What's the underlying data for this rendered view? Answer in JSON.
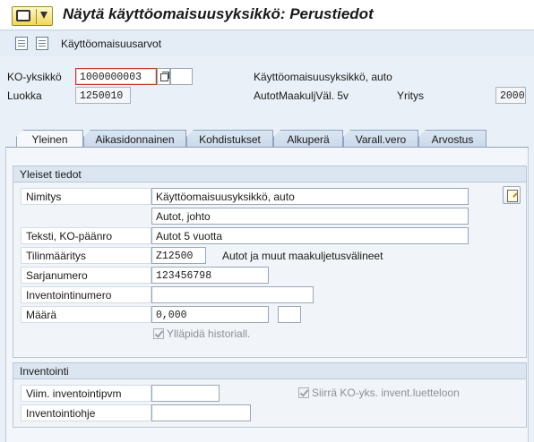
{
  "window": {
    "title": "Näytä käyttöomaisuusyksikkö:  Perustiedot"
  },
  "toolbar": {
    "asset_values_label": "Käyttöomaisuusarvot"
  },
  "header": {
    "asset_label": "KO-yksikkö",
    "asset_value": "1000000003",
    "subnumber_value": "",
    "asset_description": "Käyttöomaisuusyksikkö, auto",
    "class_label": "Luokka",
    "class_value": "1250010",
    "class_description": "AutotMaakuljVäl. 5v",
    "company_label": "Yritys",
    "company_value": "2000"
  },
  "tabs": [
    {
      "label": "Yleinen",
      "active": true
    },
    {
      "label": "Aikasidonnainen",
      "active": false
    },
    {
      "label": "Kohdistukset",
      "active": false
    },
    {
      "label": "Alkuperä",
      "active": false
    },
    {
      "label": "Varall.vero",
      "active": false
    },
    {
      "label": "Arvostus",
      "active": false
    }
  ],
  "general": {
    "title": "Yleiset tiedot",
    "description_label": "Nimitys",
    "description_1": "Käyttöomaisuusyksikkö, auto",
    "description_2": "Autot, johto",
    "main_text_label": "Teksti, KO-päänro",
    "main_text_value": "Autot 5 vuotta",
    "account_det_label": "Tilinmääritys",
    "account_det_value": "Z12500",
    "account_det_text": "Autot ja muut maakuljetusvälineet",
    "serial_label": "Sarjanumero",
    "serial_value": "123456798",
    "inventory_no_label": "Inventointinumero",
    "inventory_no_value": "",
    "quantity_label": "Määrä",
    "quantity_value": "0,000",
    "unit_value": "",
    "history_label": "Ylläpidä historiall.",
    "history_checked": true
  },
  "inventory": {
    "title": "Inventointi",
    "last_date_label": "Viim. inventointipvm",
    "last_date_value": "",
    "include_label": "Siirrä KO-yks. invent.luetteloon",
    "include_checked": true,
    "note_label": "Inventointiohje",
    "note_value": ""
  },
  "colors": {
    "background": "#eaf0f8",
    "tab_active": "#f6f8fb",
    "group_header": "#dce6f1",
    "focus_border": "#c0392b"
  }
}
